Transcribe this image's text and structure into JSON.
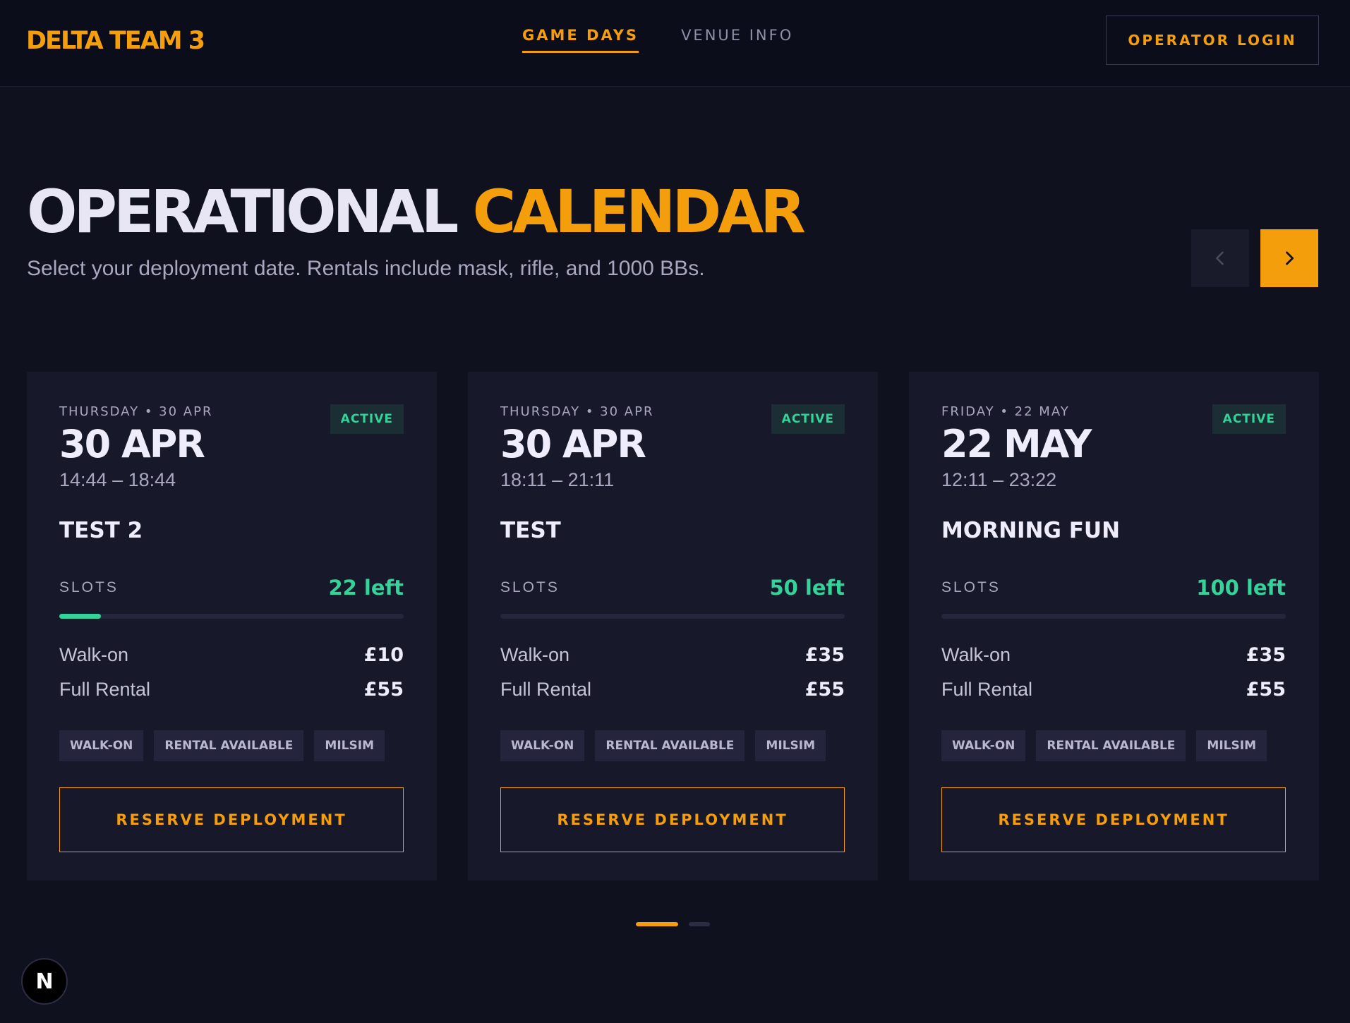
{
  "header": {
    "logo": "DELTA TEAM 3",
    "nav": [
      {
        "label": "GAME DAYS",
        "active": true
      },
      {
        "label": "VENUE INFO",
        "active": false
      }
    ],
    "login_label": "OPERATOR LOGIN"
  },
  "hero": {
    "title_part1": "OPERATIONAL",
    "title_part2": "CALENDAR",
    "subtitle": "Select your deployment date. Rentals include mask, rifle, and 1000 BBs."
  },
  "cards": [
    {
      "date_small": "THURSDAY • 30 APR",
      "date_big": "30 APR",
      "time": "14:44 – 18:44",
      "status": "ACTIVE",
      "name": "TEST 2",
      "slots_label": "SLOTS",
      "slots_left": "22 left",
      "slots_fill_fraction": 0.12,
      "walkon_label": "Walk-on",
      "walkon_price": "£10",
      "rental_label": "Full Rental",
      "rental_price": "£55",
      "tags": [
        "WALK-ON",
        "RENTAL AVAILABLE",
        "MILSIM"
      ],
      "button": "RESERVE DEPLOYMENT"
    },
    {
      "date_small": "THURSDAY • 30 APR",
      "date_big": "30 APR",
      "time": "18:11 – 21:11",
      "status": "ACTIVE",
      "name": "TEST",
      "slots_label": "SLOTS",
      "slots_left": "50 left",
      "slots_fill_fraction": 0,
      "walkon_label": "Walk-on",
      "walkon_price": "£35",
      "rental_label": "Full Rental",
      "rental_price": "£55",
      "tags": [
        "WALK-ON",
        "RENTAL AVAILABLE",
        "MILSIM"
      ],
      "button": "RESERVE DEPLOYMENT"
    },
    {
      "date_small": "FRIDAY • 22 MAY",
      "date_big": "22 MAY",
      "time": "12:11 – 23:22",
      "status": "ACTIVE",
      "name": "MORNING FUN",
      "slots_label": "SLOTS",
      "slots_left": "100 left",
      "slots_fill_fraction": 0,
      "walkon_label": "Walk-on",
      "walkon_price": "£35",
      "rental_label": "Full Rental",
      "rental_price": "£55",
      "tags": [
        "WALK-ON",
        "RENTAL AVAILABLE",
        "MILSIM"
      ],
      "button": "RESERVE DEPLOYMENT"
    }
  ],
  "pagination": {
    "current": 1,
    "total": 2
  },
  "colors": {
    "accent": "#f59e0b",
    "success": "#34d399",
    "background": "#10111f"
  },
  "icons": {
    "prev": "chevron-left-icon",
    "next": "chevron-right-icon",
    "dev_badge": "nextjs-icon"
  },
  "dev_badge_letter": "N"
}
